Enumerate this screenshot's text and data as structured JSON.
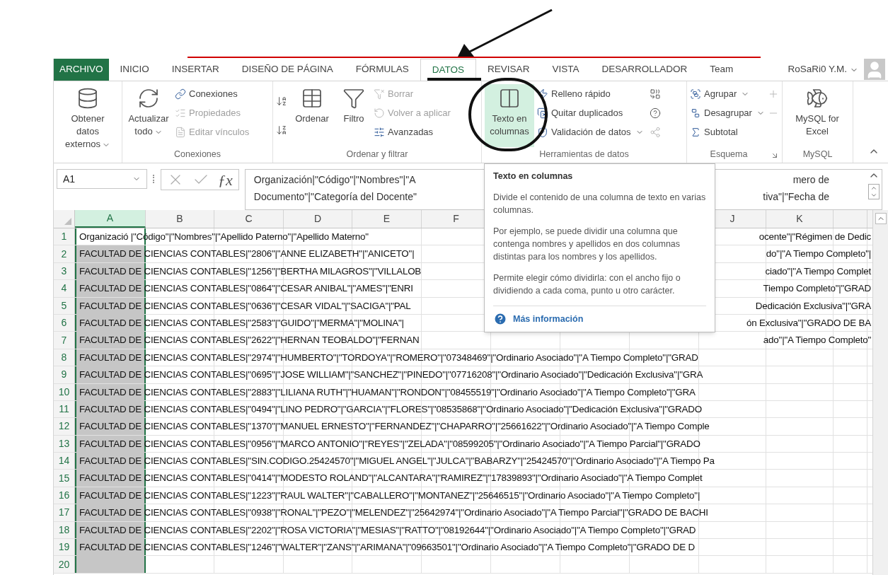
{
  "ribbon_tabs": [
    {
      "label": "ARCHIVO",
      "kind": "file",
      "selected": false
    },
    {
      "label": "INICIO",
      "kind": "tab",
      "selected": false
    },
    {
      "label": "INSERTAR",
      "kind": "tab",
      "selected": false
    },
    {
      "label": "DISEÑO DE PÁGINA",
      "kind": "tab",
      "selected": false
    },
    {
      "label": "FÓRMULAS",
      "kind": "tab",
      "selected": false
    },
    {
      "label": "DATOS",
      "kind": "tab",
      "selected": true
    },
    {
      "label": "REVISAR",
      "kind": "tab",
      "selected": false
    },
    {
      "label": "VISTA",
      "kind": "tab",
      "selected": false
    },
    {
      "label": "DESARROLLADOR",
      "kind": "tab",
      "selected": false
    },
    {
      "label": "Team",
      "kind": "tab",
      "selected": false
    }
  ],
  "account": {
    "name": "RoSaRi0 Y.M."
  },
  "ribbon_groups": [
    {
      "items": [
        {
          "label": "Obtener datos externos",
          "disabled": false,
          "dropdown": true
        }
      ]
    },
    {
      "label": "Conexiones",
      "items": [
        {
          "label": "Actualizar todo",
          "disabled": false,
          "dropdown": true
        },
        {
          "label": "Conexiones",
          "disabled": false,
          "dropdown": false
        },
        {
          "label": "Propiedades",
          "disabled": true,
          "dropdown": false
        },
        {
          "label": "Editar vínculos",
          "disabled": true,
          "dropdown": false
        }
      ]
    },
    {
      "label": "Ordenar y filtrar",
      "items": [
        {
          "label": "Ordenar",
          "disabled": false,
          "dropdown": false
        },
        {
          "label": "Filtro",
          "disabled": false,
          "dropdown": false
        },
        {
          "label": "Borrar",
          "disabled": true,
          "dropdown": false
        },
        {
          "label": "Volver a aplicar",
          "disabled": true,
          "dropdown": false
        },
        {
          "label": "Avanzadas",
          "disabled": false,
          "dropdown": false
        }
      ]
    },
    {
      "label": "Herramientas de datos",
      "items": [
        {
          "label": "Texto en columnas",
          "disabled": false,
          "dropdown": false,
          "selected": true
        },
        {
          "label": "Relleno rápido",
          "disabled": false,
          "dropdown": false
        },
        {
          "label": "Quitar duplicados",
          "disabled": false,
          "dropdown": false
        },
        {
          "label": "Validación de datos",
          "disabled": false,
          "dropdown": true
        }
      ]
    },
    {
      "label": "Esquema",
      "items": [
        {
          "label": "Agrupar",
          "disabled": false,
          "dropdown": true
        },
        {
          "label": "Desagrupar",
          "disabled": false,
          "dropdown": true
        },
        {
          "label": "Subtotal",
          "disabled": false,
          "dropdown": false
        }
      ]
    },
    {
      "label": "MySQL",
      "items": [
        {
          "label": "MySQL for Excel",
          "disabled": false,
          "dropdown": false
        }
      ]
    }
  ],
  "formula_bar": {
    "name_box": "A1",
    "fx_label": "ƒx",
    "lines": [
      {
        "left": "Organización|\"Código\"|\"Nombres\"|\"A",
        "right": "mero de"
      },
      {
        "left": "Documento\"|\"Categoría del Docente\"",
        "right": "tiva\"|\"Fecha de"
      }
    ]
  },
  "tooltip": {
    "title": "Texto en columnas",
    "paragraphs": [
      "Divide el contenido de una columna de texto en varias columnas.",
      "Por ejemplo, se puede dividir una columna que contenga nombres y apellidos en dos columnas distintas para los nombres y los apellidos.",
      "Permite elegir cómo dividirla: con el ancho fijo o dividiendo a cada coma, punto u otro carácter."
    ],
    "link": "Más información"
  },
  "columns": [
    {
      "label": "A",
      "selected": true
    },
    {
      "label": "B",
      "selected": false
    },
    {
      "label": "C",
      "selected": false
    },
    {
      "label": "D",
      "selected": false
    },
    {
      "label": "E",
      "selected": false
    },
    {
      "label": "F",
      "selected": false
    },
    {
      "label": "J",
      "selected": false
    },
    {
      "label": "K",
      "selected": false
    }
  ],
  "rows": [
    {
      "number": "1",
      "text": "Organizació |\"Código\"|\"Nombres\"|\"Apellido Paterno\"|\"Apellido Materno\"",
      "text_right": "ocente\"|\"Régimen de Dedic"
    },
    {
      "number": "2",
      "text": "FACULTAD DE CIENCIAS CONTABLES|\"2806\"|\"ANNE ELIZABETH\"|\"ANICETO\"|",
      "text_right": "do\"|\"A Tiempo Completo\"|"
    },
    {
      "number": "3",
      "text": "FACULTAD DE CIENCIAS CONTABLES|\"1256\"|\"BERTHA MILAGROS\"|\"VILLALOB",
      "text_right": "ciado\"|\"A Tiempo Complet"
    },
    {
      "number": "4",
      "text": "FACULTAD DE CIENCIAS CONTABLES|\"0864\"|\"CESAR ANIBAL\"|\"AMES\"|\"ENRI",
      "text_right": "Tiempo Completo\"|\"GRAD"
    },
    {
      "number": "5",
      "text": "FACULTAD DE CIENCIAS CONTABLES|\"0636\"|\"CESAR VIDAL\"|\"SACIGA\"|\"PAL",
      "text_right": "Dedicación Exclusiva\"|\"GRA"
    },
    {
      "number": "6",
      "text": "FACULTAD DE CIENCIAS CONTABLES|\"2583\"|\"GUIDO\"|\"MERMA\"|\"MOLINA\"|",
      "text_right": "ón Exclusiva\"|\"GRADO DE BA"
    },
    {
      "number": "7",
      "text": "FACULTAD DE CIENCIAS CONTABLES|\"2622\"|\"HERNAN TEOBALDO\"|\"FERNAN",
      "text_right": "ado\"|\"A Tiempo Completo\""
    },
    {
      "number": "8",
      "text": "FACULTAD DE CIENCIAS CONTABLES|\"2974\"|\"HUMBERTO\"|\"TORDOYA\"|\"ROMERO\"|\"07348469\"|\"Ordinario Asociado\"|\"A Tiempo Completo\"|\"GRAD"
    },
    {
      "number": "9",
      "text": "FACULTAD DE CIENCIAS CONTABLES|\"0695\"|\"JOSE WILLIAM\"|\"SANCHEZ\"|\"PINEDO\"|\"07716208\"|\"Ordinario Asociado\"|\"Dedicación Exclusiva\"|\"GRA"
    },
    {
      "number": "10",
      "text": "FACULTAD DE CIENCIAS CONTABLES|\"2883\"|\"LILIANA RUTH\"|\"HUAMAN\"|\"RONDON\"|\"08455519\"|\"Ordinario Asociado\"|\"A Tiempo Completo\"|\"GRA"
    },
    {
      "number": "11",
      "text": "FACULTAD DE CIENCIAS CONTABLES|\"0494\"|\"LINO PEDRO\"|\"GARCIA\"|\"FLORES\"|\"08535868\"|\"Ordinario Asociado\"|\"Dedicación Exclusiva\"|\"GRADO"
    },
    {
      "number": "12",
      "text": "FACULTAD DE CIENCIAS CONTABLES|\"1370\"|\"MANUEL ERNESTO\"|\"FERNANDEZ\"|\"CHAPARRO\"|\"25661622\"|\"Ordinario Asociado\"|\"A Tiempo Comple"
    },
    {
      "number": "13",
      "text": "FACULTAD DE CIENCIAS CONTABLES|\"0956\"|\"MARCO ANTONIO\"|\"REYES\"|\"ZELADA\"|\"08599205\"|\"Ordinario Asociado\"|\"A Tiempo Parcial\"|\"GRADO"
    },
    {
      "number": "14",
      "text": "FACULTAD DE CIENCIAS CONTABLES|\"SIN.CODIGO.25424570\"|\"MIGUEL ANGEL\"|\"JULCA\"|\"BABARZY\"|\"25424570\"|\"Ordinario Asociado\"|\"A Tiempo Pa"
    },
    {
      "number": "15",
      "text": "FACULTAD DE CIENCIAS CONTABLES|\"0414\"|\"MODESTO ROLAND\"|\"ALCANTARA\"|\"RAMIREZ\"|\"17839893\"|\"Ordinario Asociado\"|\"A Tiempo Complet"
    },
    {
      "number": "16",
      "text": "FACULTAD DE CIENCIAS CONTABLES|\"1223\"|\"RAUL WALTER\"|\"CABALLERO\"|\"MONTANEZ\"|\"25646515\"|\"Ordinario Asociado\"|\"A Tiempo Completo\"|"
    },
    {
      "number": "17",
      "text": "FACULTAD DE CIENCIAS CONTABLES|\"0938\"|\"RONAL\"|\"PEZO\"|\"MELENDEZ\"|\"25642974\"|\"Ordinario Asociado\"|\"A Tiempo Parcial\"|\"GRADO DE BACHI"
    },
    {
      "number": "18",
      "text": "FACULTAD DE CIENCIAS CONTABLES|\"2202\"|\"ROSA VICTORIA\"|\"MESIAS\"|\"RATTO\"|\"08192644\"|\"Ordinario Asociado\"|\"A Tiempo Completo\"|\"GRAD"
    },
    {
      "number": "19",
      "text": "FACULTAD DE CIENCIAS CONTABLES|\"1246\"|\"WALTER\"|\"ZANS\"|\"ARIMANA\"|\"09663501\"|\"Ordinario Asociado\"|\"A Tiempo Completo\"|\"GRADO DE D"
    },
    {
      "number": "20"
    }
  ]
}
